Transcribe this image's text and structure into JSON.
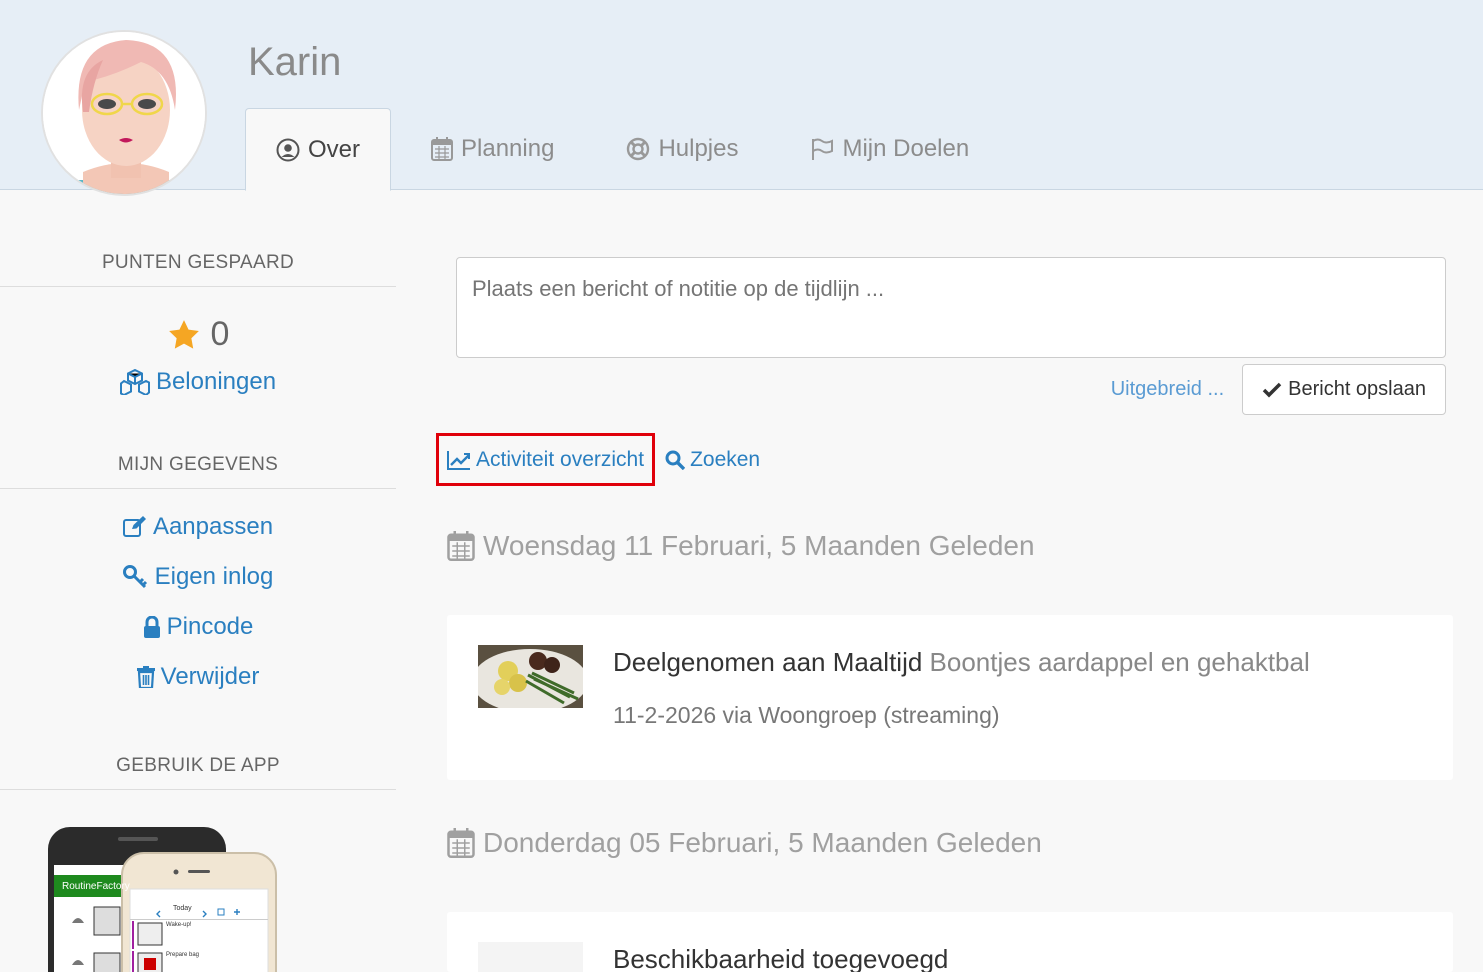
{
  "user": {
    "name": "Karin"
  },
  "tabs": [
    {
      "label": "Over",
      "icon": "user-circle-icon",
      "active": true
    },
    {
      "label": "Planning",
      "icon": "calendar-icon",
      "active": false
    },
    {
      "label": "Hulpjes",
      "icon": "life-ring-icon",
      "active": false
    },
    {
      "label": "Mijn Doelen",
      "icon": "flag-icon",
      "active": false
    }
  ],
  "sidebar": {
    "points_heading": "PUNTEN GESPAARD",
    "points_value": "0",
    "rewards_label": "Beloningen",
    "my_data_heading": "MIJN GEGEVENS",
    "edit_label": "Aanpassen",
    "login_label": "Eigen inlog",
    "pin_label": "Pincode",
    "delete_label": "Verwijder",
    "app_heading": "GEBRUIK DE APP",
    "app_brand": "RoutineFactory",
    "app_today": "Today",
    "app_items": [
      "Wake-up!",
      "Prepare bag"
    ]
  },
  "composer": {
    "placeholder": "Plaats een bericht of notitie op de tijdlijn ...",
    "extended_label": "Uitgebreid ...",
    "save_label": "Bericht opslaan"
  },
  "links": {
    "activity_label": "Activiteit overzicht",
    "search_label": "Zoeken"
  },
  "timeline": [
    {
      "date": "Woensdag 11 Februari, 5 Maanden Geleden",
      "title": "Deelgenomen aan Maaltijd",
      "subtitle": "Boontjes aardappel en gehaktbal",
      "meta": "11-2-2026 via Woongroep (streaming)"
    },
    {
      "date": "Donderdag 05 Februari, 5 Maanden Geleden",
      "title": "Beschikbaarheid toegevoegd",
      "subtitle": "",
      "meta": ""
    }
  ],
  "colors": {
    "link": "#2a7fc0",
    "star": "#f5a623",
    "highlight": "#e0000a",
    "header_bg": "#e6eef6"
  }
}
